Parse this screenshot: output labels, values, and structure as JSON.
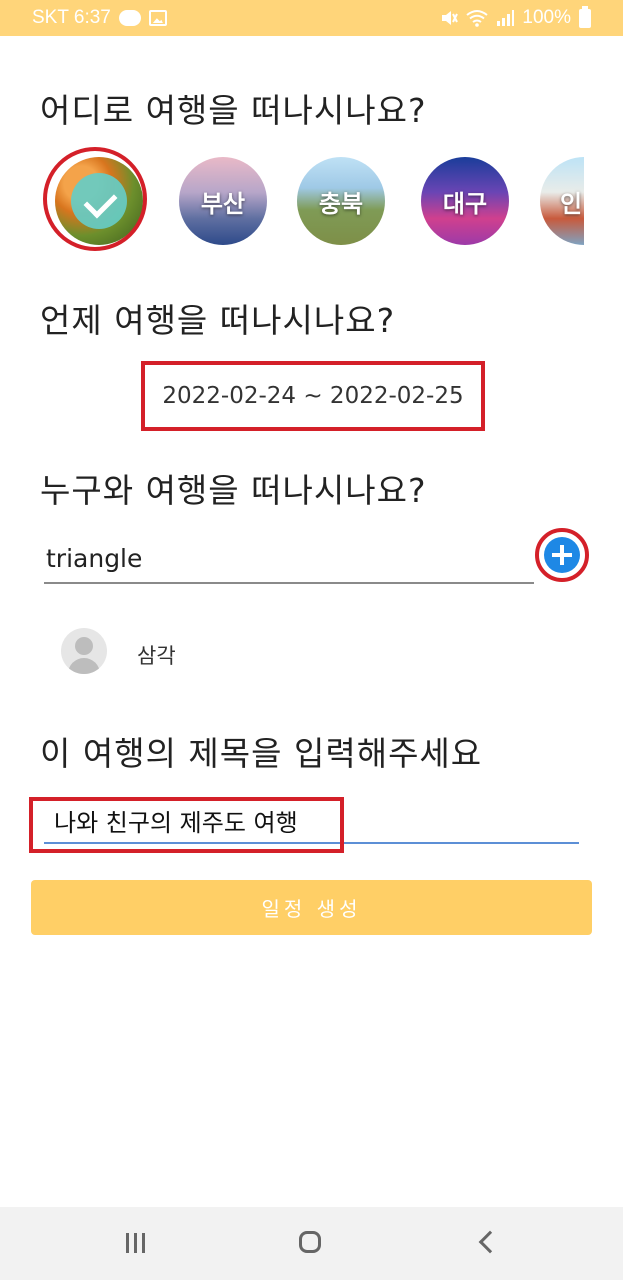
{
  "status_bar": {
    "carrier_time": "SKT 6:37",
    "battery": "100%"
  },
  "sections": {
    "where": "어디로 여행을 떠나시나요?",
    "when": "언제 여행을 떠나시나요?",
    "who": "누구와 여행을 떠나시나요?",
    "title": "이 여행의 제목을 입력해주세요"
  },
  "regions": [
    {
      "label": "",
      "selected": true
    },
    {
      "label": "부산",
      "selected": false
    },
    {
      "label": "충북",
      "selected": false
    },
    {
      "label": "대구",
      "selected": false
    },
    {
      "label": "인",
      "selected": false
    }
  ],
  "date_range": "2022-02-24 ~ 2022-02-25",
  "companion": {
    "input_value": "triangle",
    "members": [
      {
        "name": "삼각"
      }
    ]
  },
  "trip_title_value": "나와 친구의 제주도 여행",
  "create_button_label": "일정 생성",
  "colors": {
    "status_bar": "#ffd57a",
    "button": "#ffcf66",
    "highlight": "#d42029",
    "add_button": "#1e88e5",
    "check_overlay": "#66ccc4"
  }
}
